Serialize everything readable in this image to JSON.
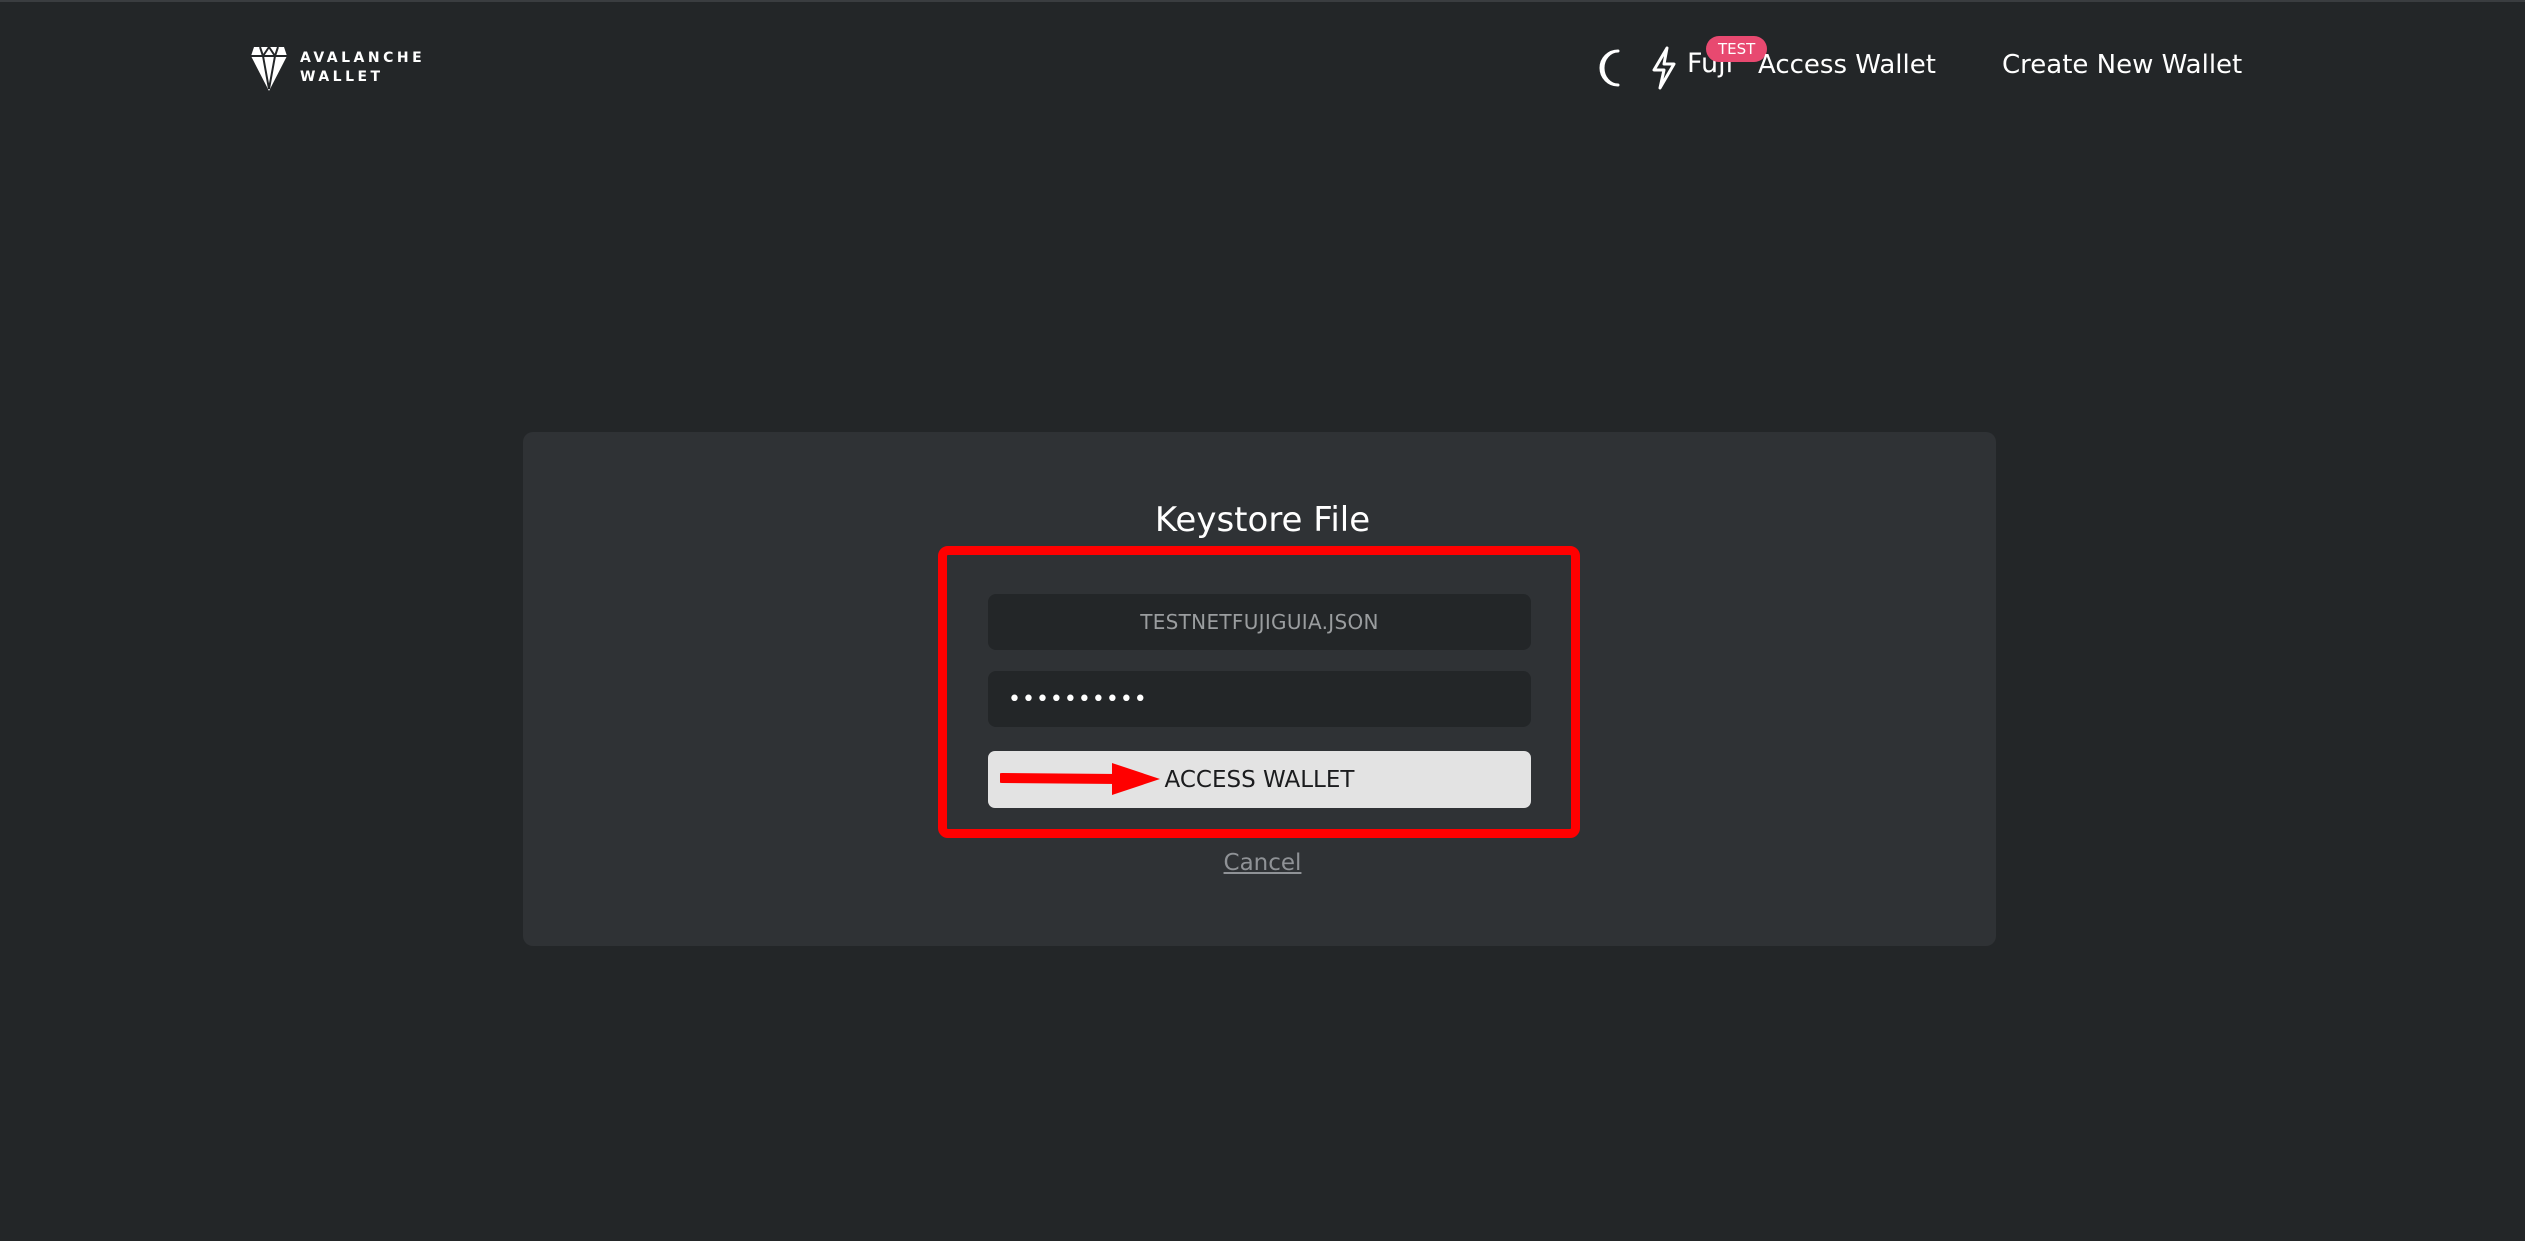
{
  "header": {
    "logo": {
      "line1": "AVALANCHE",
      "line2": "WALLET"
    },
    "network": {
      "name": "Fuji",
      "badge": "TEST",
      "badge_color": "#e84970"
    },
    "nav": {
      "access_label": "Access Wallet",
      "create_label": "Create New Wallet"
    },
    "icons": {
      "theme": "moon-icon",
      "network": "lightning-bolt-icon"
    }
  },
  "card": {
    "title": "Keystore File",
    "file_name": "TESTNETFUJIGUIA.JSON",
    "password_masked": "••••••••••",
    "submit_label": "ACCESS WALLET",
    "cancel_label": "Cancel"
  },
  "annotation": {
    "highlight_color": "#ff0000",
    "arrow_color": "#ff0000"
  },
  "colors": {
    "background": "#232628",
    "card": "#2f3235",
    "button": "#e3e3e3"
  }
}
